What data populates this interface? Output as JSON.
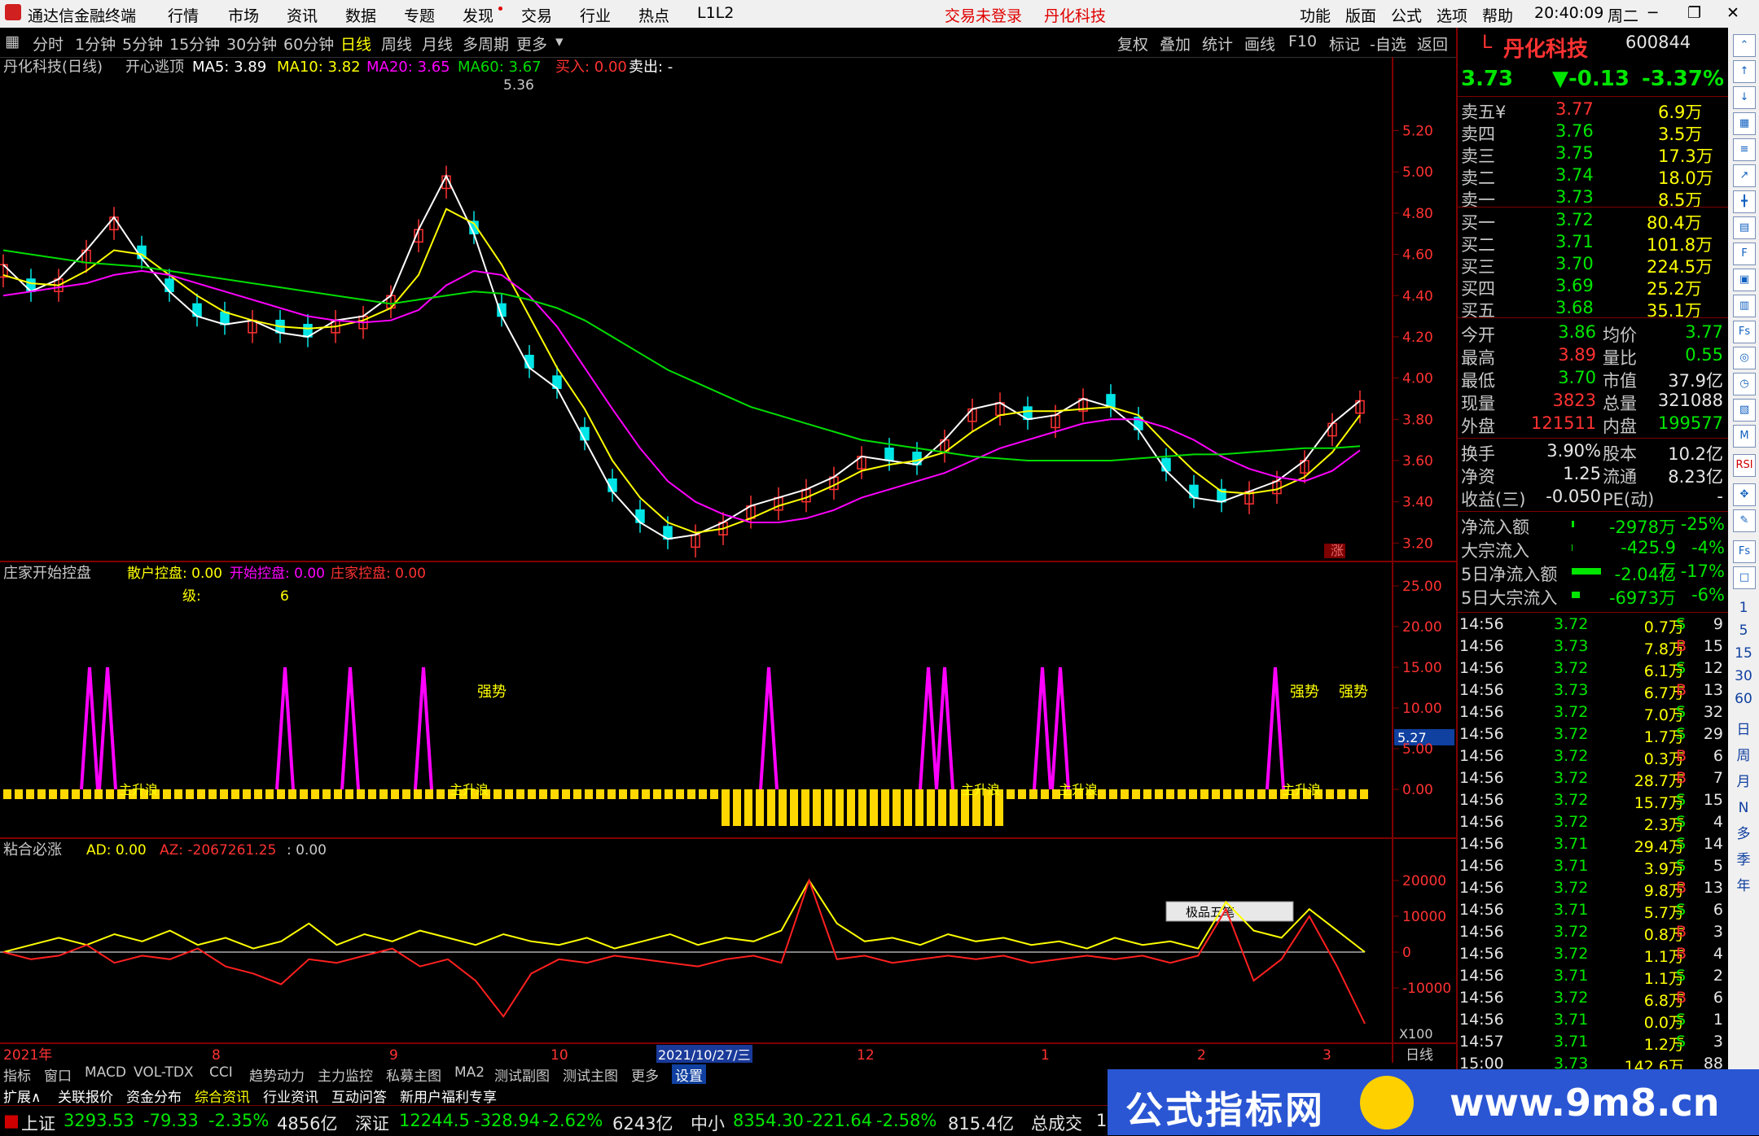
{
  "titlebar": {
    "app": "通达信金融终端",
    "menus": [
      "行情",
      "市场",
      "资讯",
      "数据",
      "专题",
      "发现",
      "交易",
      "行业",
      "热点",
      "L1L2"
    ],
    "status": "交易未登录",
    "stock": "丹化科技",
    "right_menus": [
      "功能",
      "版面",
      "公式",
      "选项",
      "帮助"
    ],
    "time": "20:40:09",
    "weekday": "周二"
  },
  "periods": {
    "items": [
      "分时",
      "1分钟",
      "5分钟",
      "15分钟",
      "30分钟",
      "60分钟",
      "日线",
      "周线",
      "月线",
      "多周期",
      "更多"
    ],
    "active": "日线",
    "right_items": [
      "复权",
      "叠加",
      "统计",
      "画线",
      "F10",
      "标记",
      "-自选",
      "返回"
    ]
  },
  "main_chart": {
    "title": "丹化科技(日线)",
    "indicator": "开心逃顶",
    "ma5_label": "MA5: 3.89",
    "ma10_label": "MA10: 3.82",
    "ma20_label": "MA20: 3.65",
    "ma60_label": "MA60: 3.67",
    "buy_label": "买入: 0.00",
    "sell_label": "卖出: -",
    "peak_label": "5.36",
    "y_ticks": [
      "5.20",
      "5.00",
      "4.80",
      "4.60",
      "4.40",
      "4.20",
      "4.00",
      "3.80",
      "3.60",
      "3.40",
      "3.20"
    ],
    "zhang_label": "涨"
  },
  "chart_data": [
    {
      "type": "line",
      "title": "丹化科技(日线)",
      "ylim": [
        3.15,
        5.36
      ],
      "series": [
        {
          "name": "MA5",
          "color": "#ffffff",
          "values": [
            4.55,
            4.42,
            4.48,
            4.62,
            4.78,
            4.58,
            4.42,
            4.3,
            4.26,
            4.28,
            4.22,
            4.2,
            4.28,
            4.3,
            4.4,
            4.72,
            4.98,
            4.7,
            4.3,
            4.05,
            3.95,
            3.7,
            3.45,
            3.3,
            3.22,
            3.24,
            3.3,
            3.38,
            3.42,
            3.46,
            3.52,
            3.62,
            3.6,
            3.58,
            3.7,
            3.85,
            3.88,
            3.8,
            3.82,
            3.9,
            3.86,
            3.75,
            3.55,
            3.42,
            3.4,
            3.45,
            3.5,
            3.6,
            3.78,
            3.89
          ]
        },
        {
          "name": "MA10",
          "color": "#ffff00",
          "values": [
            4.5,
            4.46,
            4.45,
            4.52,
            4.62,
            4.6,
            4.5,
            4.4,
            4.32,
            4.28,
            4.25,
            4.24,
            4.25,
            4.28,
            4.34,
            4.5,
            4.82,
            4.75,
            4.55,
            4.3,
            4.05,
            3.85,
            3.6,
            3.42,
            3.3,
            3.25,
            3.27,
            3.32,
            3.38,
            3.42,
            3.48,
            3.55,
            3.58,
            3.6,
            3.64,
            3.74,
            3.82,
            3.84,
            3.84,
            3.85,
            3.86,
            3.82,
            3.68,
            3.55,
            3.45,
            3.44,
            3.46,
            3.52,
            3.64,
            3.82
          ]
        },
        {
          "name": "MA20",
          "color": "#ff00ff",
          "values": [
            4.4,
            4.42,
            4.44,
            4.46,
            4.5,
            4.52,
            4.5,
            4.46,
            4.42,
            4.38,
            4.34,
            4.3,
            4.28,
            4.27,
            4.28,
            4.33,
            4.45,
            4.52,
            4.5,
            4.4,
            4.25,
            4.05,
            3.85,
            3.66,
            3.5,
            3.4,
            3.34,
            3.3,
            3.3,
            3.32,
            3.36,
            3.42,
            3.46,
            3.5,
            3.54,
            3.6,
            3.66,
            3.7,
            3.74,
            3.78,
            3.8,
            3.8,
            3.76,
            3.7,
            3.62,
            3.56,
            3.52,
            3.5,
            3.55,
            3.65
          ]
        },
        {
          "name": "MA60",
          "color": "#00dd00",
          "values": [
            4.62,
            4.6,
            4.58,
            4.56,
            4.55,
            4.54,
            4.52,
            4.5,
            4.48,
            4.46,
            4.44,
            4.42,
            4.4,
            4.38,
            4.36,
            4.38,
            4.4,
            4.42,
            4.41,
            4.38,
            4.34,
            4.28,
            4.2,
            4.12,
            4.04,
            3.98,
            3.92,
            3.86,
            3.82,
            3.78,
            3.74,
            3.7,
            3.68,
            3.66,
            3.64,
            3.62,
            3.61,
            3.6,
            3.6,
            3.6,
            3.6,
            3.61,
            3.62,
            3.63,
            3.63,
            3.64,
            3.65,
            3.66,
            3.66,
            3.67
          ]
        }
      ]
    },
    {
      "type": "bar",
      "title": "庄家开始控盘",
      "ylim": [
        -5,
        25
      ],
      "y_ticks": [
        "25.00",
        "20.00",
        "15.00",
        "10.00",
        "5.00",
        "0.00"
      ]
    },
    {
      "type": "line",
      "title": "粘合必涨",
      "ylim": [
        -25000,
        25000
      ],
      "y_ticks": [
        "20000",
        "10000",
        "0",
        "-10000"
      ],
      "series": [
        {
          "name": "AD",
          "color": "#ffff00",
          "values": [
            0,
            2000,
            4000,
            2000,
            5000,
            3000,
            6000,
            2000,
            4000,
            1000,
            3000,
            8000,
            2000,
            5000,
            3000,
            6000,
            4000,
            2000,
            5000,
            3000,
            2000,
            4000,
            1000,
            3000,
            5000,
            2000,
            4000,
            3000,
            6000,
            20000,
            8000,
            3000,
            4000,
            2000,
            5000,
            3000,
            4000,
            2000,
            3000,
            1000,
            4000,
            2000,
            3000,
            1000,
            14000,
            6000,
            4000,
            12000,
            6000,
            0
          ]
        },
        {
          "name": "AZ",
          "color": "#ff2020",
          "values": [
            0,
            -2000,
            -1000,
            2000,
            -3000,
            -1000,
            -2000,
            1000,
            -4000,
            -6000,
            -9000,
            -2000,
            -3000,
            -1000,
            1000,
            -4000,
            -2000,
            -8000,
            -18000,
            -6000,
            -2000,
            -3000,
            -1000,
            -2000,
            -3000,
            -4000,
            -2000,
            -1000,
            -3000,
            20000,
            -2000,
            -1000,
            -3000,
            -2000,
            -1000,
            -2000,
            -1000,
            -3000,
            -2000,
            -1000,
            -2000,
            -1000,
            -3000,
            -1000,
            12000,
            -8000,
            -2000,
            10000,
            -4000,
            -20000
          ]
        }
      ]
    }
  ],
  "sub1": {
    "title": "庄家开始控盘",
    "l1": "散户控盘: 0.00",
    "l2": "开始控盘: 0.00",
    "l3": "庄家控盘: 0.00",
    "l4": "级:",
    "l4val": "6",
    "strong1": "强势",
    "strong2": "强势",
    "strong3": "强势",
    "marker": "5.27",
    "zhu_label": "主升浪"
  },
  "sub2": {
    "title": "粘合必涨",
    "ad": "AD: 0.00",
    "az": "AZ: -2067261.25",
    "extra": ": 0.00",
    "x100": "X100",
    "ime": "极品五笔"
  },
  "xaxis": {
    "labels": [
      "2021年",
      "8",
      "9",
      "10",
      "2021/10/27/三",
      "12",
      "1",
      "2",
      "3"
    ],
    "period": "日线"
  },
  "quote": {
    "code_prefix": "L",
    "name": "丹化科技",
    "code": "600844",
    "price": "3.73",
    "change": "▼-0.13",
    "pct": "-3.37%",
    "asks": [
      {
        "label": "卖五",
        "mark": "¥",
        "price": "3.77",
        "vol": "6.9万",
        "pc": "up"
      },
      {
        "label": "卖四",
        "mark": "",
        "price": "3.76",
        "vol": "3.5万",
        "pc": "dn"
      },
      {
        "label": "卖三",
        "mark": "",
        "price": "3.75",
        "vol": "17.3万",
        "pc": "dn"
      },
      {
        "label": "卖二",
        "mark": "",
        "price": "3.74",
        "vol": "18.0万",
        "pc": "dn"
      },
      {
        "label": "卖一",
        "mark": "",
        "price": "3.73",
        "vol": "8.5万",
        "pc": "dn"
      }
    ],
    "bids": [
      {
        "label": "买一",
        "price": "3.72",
        "vol": "80.4万",
        "pc": "dn"
      },
      {
        "label": "买二",
        "price": "3.71",
        "vol": "101.8万",
        "pc": "dn"
      },
      {
        "label": "买三",
        "price": "3.70",
        "vol": "224.5万",
        "pc": "dn"
      },
      {
        "label": "买四",
        "price": "3.69",
        "vol": "25.2万",
        "pc": "dn"
      },
      {
        "label": "买五",
        "price": "3.68",
        "vol": "35.1万",
        "pc": "dn"
      }
    ],
    "stats": [
      {
        "l1": "今开",
        "v1": "3.86",
        "c1": "dn",
        "l2": "均价",
        "v2": "3.77",
        "c2": "dn"
      },
      {
        "l1": "最高",
        "v1": "3.89",
        "c1": "up",
        "l2": "量比",
        "v2": "0.55",
        "c2": "dn"
      },
      {
        "l1": "最低",
        "v1": "3.70",
        "c1": "dn",
        "l2": "市值",
        "v2": "37.9亿",
        "c2": "wh"
      },
      {
        "l1": "现量",
        "v1": "3823",
        "c1": "up",
        "l2": "总量",
        "v2": "321088",
        "c2": "wh"
      },
      {
        "l1": "外盘",
        "v1": "121511",
        "c1": "up",
        "l2": "内盘",
        "v2": "199577",
        "c2": "dn"
      }
    ],
    "stats2": [
      {
        "l1": "换手",
        "v1": "3.90%",
        "l2": "股本",
        "v2": "10.2亿"
      },
      {
        "l1": "净资",
        "v1": "1.25",
        "l2": "流通",
        "v2": "8.23亿"
      },
      {
        "l1": "收益(三)",
        "v1": "-0.050",
        "l2": "PE(动)",
        "v2": "-"
      }
    ],
    "flows": [
      {
        "label": "净流入额",
        "v": "-2978万",
        "p": "-25%",
        "bar": 3
      },
      {
        "label": "大宗流入",
        "v": "-425.9万",
        "p": "-4%",
        "bar": 1
      },
      {
        "label": "5日净流入额",
        "v": "-2.04亿",
        "p": "-17%",
        "bar": 36
      },
      {
        "label": "5日大宗流入",
        "v": "-6973万",
        "p": "-6%",
        "bar": 10
      }
    ],
    "ticks": [
      {
        "t": "14:56",
        "p": "3.72",
        "v": "0.7万",
        "s": "S",
        "n": "9"
      },
      {
        "t": "14:56",
        "p": "3.73",
        "v": "7.8万",
        "s": "B",
        "n": "15"
      },
      {
        "t": "14:56",
        "p": "3.72",
        "v": "6.1万",
        "s": "S",
        "n": "12"
      },
      {
        "t": "14:56",
        "p": "3.73",
        "v": "6.7万",
        "s": "B",
        "n": "13"
      },
      {
        "t": "14:56",
        "p": "3.72",
        "v": "7.0万",
        "s": "S",
        "n": "32"
      },
      {
        "t": "14:56",
        "p": "3.72",
        "v": "1.7万",
        "s": "S",
        "n": "29"
      },
      {
        "t": "14:56",
        "p": "3.72",
        "v": "0.3万",
        "s": "B",
        "n": "6"
      },
      {
        "t": "14:56",
        "p": "3.72",
        "v": "28.7万",
        "s": "B",
        "n": "7"
      },
      {
        "t": "14:56",
        "p": "3.72",
        "v": "15.7万",
        "s": "S",
        "n": "15"
      },
      {
        "t": "14:56",
        "p": "3.72",
        "v": "2.3万",
        "s": "S",
        "n": "4"
      },
      {
        "t": "14:56",
        "p": "3.71",
        "v": "29.4万",
        "s": "S",
        "n": "14"
      },
      {
        "t": "14:56",
        "p": "3.71",
        "v": "3.9万",
        "s": "S",
        "n": "5"
      },
      {
        "t": "14:56",
        "p": "3.72",
        "v": "9.8万",
        "s": "B",
        "n": "13"
      },
      {
        "t": "14:56",
        "p": "3.71",
        "v": "5.7万",
        "s": "S",
        "n": "6"
      },
      {
        "t": "14:56",
        "p": "3.72",
        "v": "0.8万",
        "s": "B",
        "n": "3"
      },
      {
        "t": "14:56",
        "p": "3.72",
        "v": "1.1万",
        "s": "B",
        "n": "4"
      },
      {
        "t": "14:56",
        "p": "3.71",
        "v": "1.1万",
        "s": "S",
        "n": "2"
      },
      {
        "t": "14:56",
        "p": "3.72",
        "v": "6.8万",
        "s": "B",
        "n": "6"
      },
      {
        "t": "14:56",
        "p": "3.71",
        "v": "0.0万",
        "s": "S",
        "n": "1"
      },
      {
        "t": "14:57",
        "p": "3.71",
        "v": "1.2万",
        "s": "S",
        "n": "3"
      },
      {
        "t": "15:00",
        "p": "3.73",
        "v": "142.6万",
        "s": "",
        "n": "88"
      }
    ]
  },
  "iconstrip": {
    "labels": [
      "日",
      "周",
      "月",
      "N",
      "多",
      "季",
      "年"
    ],
    "nums": [
      "1",
      "5",
      "15",
      "30",
      "60"
    ]
  },
  "tabs1": [
    "指标",
    "窗口",
    "MACD",
    "VOL-TDX",
    "CCI",
    "趋势动力",
    "主力监控",
    "私募主图",
    "MA2",
    "测试副图",
    "测试主图",
    "更多",
    "设置"
  ],
  "tabs2": [
    "扩展∧",
    "关联报价",
    "资金分布",
    "综合资讯",
    "行业资讯",
    "互动问答",
    "新用户福利专享"
  ],
  "indexbar": {
    "sh_label": "上证",
    "sh": "3293.53",
    "sh_chg": "-79.33",
    "sh_pct": "-2.35%",
    "sh_amt": "4856亿",
    "sz_label": "深证",
    "sz": "12244.5",
    "sz_chg": "-328.94",
    "sz_pct": "-2.62%",
    "sz_amt": "6243亿",
    "zx_label": "中小",
    "zx": "8354.30",
    "zx_chg": "-221.64",
    "zx_pct": "-2.58%",
    "zx_amt": "815.4亿",
    "total_label": "总成交",
    "total": "1"
  },
  "banner": {
    "text1": "公式指标网",
    "text2": "www.9m8.cn"
  },
  "colors": {
    "up": "#ff3232",
    "down": "#00e600",
    "ma5": "#ffffff",
    "ma10": "#ffff00",
    "ma20": "#ff00ff",
    "ma60": "#00dd00",
    "axis": "#800000"
  }
}
